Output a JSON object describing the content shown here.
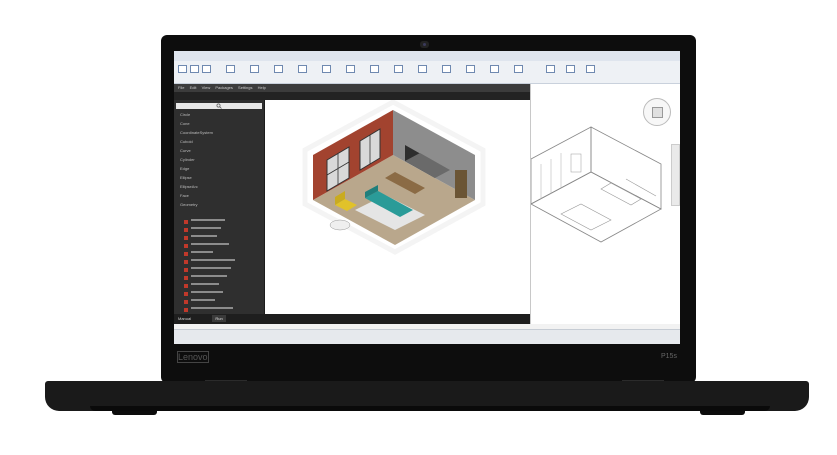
{
  "device": {
    "bezel_brand": "Lenovo",
    "model_badge": "P15s"
  },
  "editor": {
    "menu": [
      "File",
      "Edit",
      "View",
      "Packages",
      "Settings",
      "Help"
    ],
    "library_items": [
      "Circle",
      "Cone",
      "CoordinateSystem",
      "Cuboid",
      "Curve",
      "Cylinder",
      "Edge",
      "Ellipse",
      "EllipseArc",
      "Face",
      "Geometry"
    ],
    "run_mode": "Manual",
    "run_button": "Run"
  },
  "colors": {
    "bezel": "#0d0d0d",
    "base": "#1a1a1a",
    "editor_bg": "#2b2b2b",
    "brick": "#a2432f",
    "teal_sofa": "#2a9b98",
    "yellow_chair": "#e1c22a"
  },
  "icons": [
    "search-icon",
    "webcam-icon",
    "viewcube-icon"
  ]
}
